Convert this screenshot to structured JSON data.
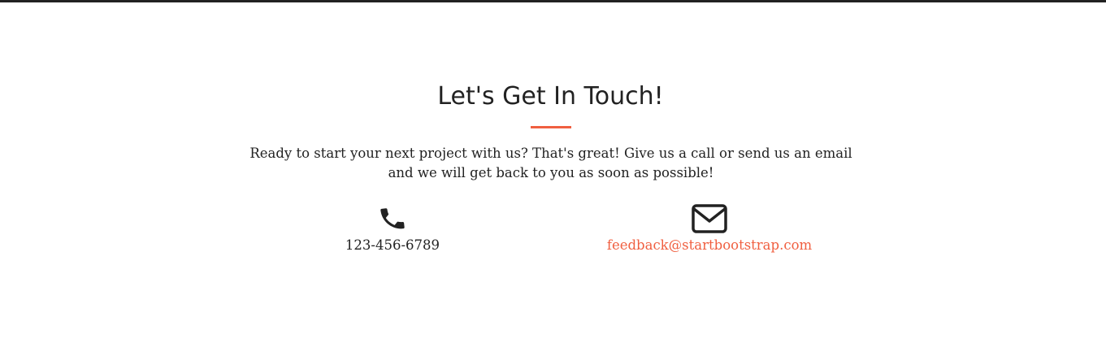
{
  "contact": {
    "heading": "Let's Get In Touch!",
    "lead": "Ready to start your next project with us? That's great! Give us a call or send us an email and we will get back to you as soon as possible!",
    "phone": {
      "icon": "phone-icon",
      "number": "123-456-6789"
    },
    "email": {
      "icon": "envelope-icon",
      "address": "feedback@startbootstrap.com"
    }
  },
  "colors": {
    "accent": "#f05f40",
    "text": "#222222",
    "top_rule": "#222222",
    "background": "#ffffff"
  }
}
